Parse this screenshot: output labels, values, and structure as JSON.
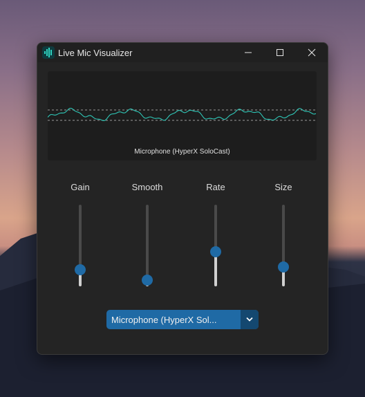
{
  "window": {
    "title": "Live Mic Visualizer",
    "icons": {
      "app": "waveform-app-icon",
      "minimize": "minimize-icon",
      "maximize": "maximize-icon",
      "close": "close-icon"
    }
  },
  "visualizer": {
    "label": "Microphone (HyperX SoloCast)",
    "wave_color": "#2fc8b8"
  },
  "sliders": [
    {
      "label": "Gain",
      "level": 0.2
    },
    {
      "label": "Smooth",
      "level": 0.08
    },
    {
      "label": "Rate",
      "level": 0.42
    },
    {
      "label": "Size",
      "level": 0.24
    }
  ],
  "device_select": {
    "value": "Microphone (HyperX Sol...",
    "icon": "chevron-down-icon"
  },
  "colors": {
    "accent": "#1f6aa5",
    "accent_dark": "#144870",
    "window_bg": "#242424"
  }
}
